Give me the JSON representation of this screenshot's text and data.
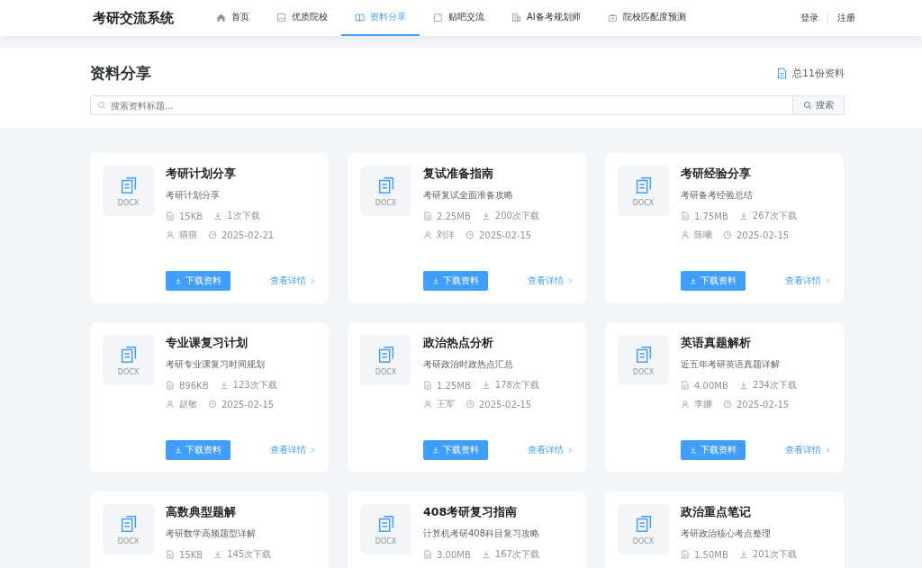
{
  "header": {
    "logo": "考研交流系统",
    "nav": [
      {
        "label": "首页",
        "kind": "home",
        "selected": false
      },
      {
        "label": "优质院校",
        "kind": "image",
        "selected": false
      },
      {
        "label": "资料分享",
        "kind": "book",
        "selected": true
      },
      {
        "label": "贴吧交流",
        "kind": "chat",
        "selected": false
      },
      {
        "label": "AI备考规划师",
        "kind": "building",
        "selected": false
      },
      {
        "label": "院校匹配度预测",
        "kind": "bag",
        "selected": false
      }
    ],
    "login": "登录",
    "register": "注册"
  },
  "page": {
    "title": "资料分享",
    "total": "总11份资料",
    "search": {
      "placeholder": "搜索资料标题...",
      "button": "搜索"
    }
  },
  "cards": [
    {
      "type": "DOCX",
      "title": "考研计划分享",
      "desc": "考研计划分享",
      "size": "15KB",
      "downloads": "1次下载",
      "author": "猫猫",
      "date": "2025-02-21",
      "download_button": "下载资料",
      "detail_link": "查看详情"
    },
    {
      "type": "DOCX",
      "title": "复试准备指南",
      "desc": "考研复试全面准备攻略",
      "size": "2.25MB",
      "downloads": "200次下载",
      "author": "刘洋",
      "date": "2025-02-15",
      "download_button": "下载资料",
      "detail_link": "查看详情"
    },
    {
      "type": "DOCX",
      "title": "考研经验分享",
      "desc": "考研备考经验总结",
      "size": "1.75MB",
      "downloads": "267次下载",
      "author": "陈曦",
      "date": "2025-02-15",
      "download_button": "下载资料",
      "detail_link": "查看详情"
    },
    {
      "type": "DOCX",
      "title": "专业课复习计划",
      "desc": "考研专业课复习时间规划",
      "size": "896KB",
      "downloads": "123次下载",
      "author": "赵敏",
      "date": "2025-02-15",
      "download_button": "下载资料",
      "detail_link": "查看详情"
    },
    {
      "type": "DOCX",
      "title": "政治热点分析",
      "desc": "考研政治时政热点汇总",
      "size": "1.25MB",
      "downloads": "178次下载",
      "author": "王军",
      "date": "2025-02-15",
      "download_button": "下载资料",
      "detail_link": "查看详情"
    },
    {
      "type": "DOCX",
      "title": "英语真题解析",
      "desc": "近五年考研英语真题详解",
      "size": "4.00MB",
      "downloads": "234次下载",
      "author": "李娜",
      "date": "2025-02-15",
      "download_button": "下载资料",
      "detail_link": "查看详情"
    },
    {
      "type": "DOCX",
      "title": "高数典型题解",
      "desc": "考研数学高频题型详解",
      "size": "15KB",
      "downloads": "145次下载"
    },
    {
      "type": "DOCX",
      "title": "408考研复习指南",
      "desc": "计算机考研408科目复习攻略",
      "size": "3.00MB",
      "downloads": "167次下载"
    },
    {
      "type": "DOCX",
      "title": "政治重点笔记",
      "desc": "考研政治核心考点整理",
      "size": "1.50MB",
      "downloads": "201次下载"
    }
  ]
}
